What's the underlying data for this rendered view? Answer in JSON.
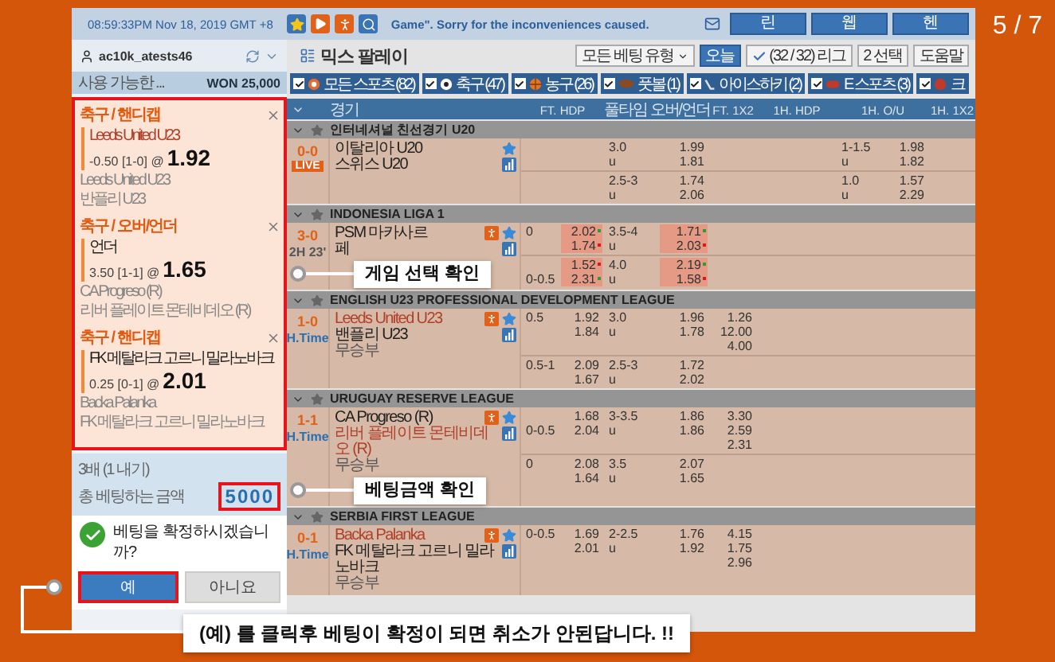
{
  "slide_counter": "5 / 7",
  "topbar": {
    "time": "08:59:33PM Nov 18, 2019 GMT +8",
    "notice": "Game\". Sorry for the inconveniences caused.",
    "buttons": [
      "린",
      "웹",
      "헨"
    ]
  },
  "account": {
    "username": "ac10k_atests46",
    "balance_label": "사용 가능한 ...",
    "balance": "WON 25,000"
  },
  "bet_slip": [
    {
      "category": "축구 / 핸디캡",
      "pick": "Leeds United U23",
      "favourite": true,
      "line": "-0.50 [1-0] @",
      "odds": "1.92",
      "home": "Leeds United U23",
      "away": "반플리 U23"
    },
    {
      "category": "축구 / 오버/언더",
      "pick": "언더",
      "favourite": false,
      "line": "3.50 [1-1] @",
      "odds": "1.65",
      "home": "CA Progreso (R)",
      "away": "리버 플레이트 몬테비데오 (R)"
    },
    {
      "category": "축구 / 핸디캡",
      "pick": "FK 메탈라크 고르니 밀라노바크",
      "favourite": false,
      "line": "0.25 [0-1] @",
      "odds": "2.01",
      "home": "Backa Palanka",
      "away": "FK 메탈라크 고르니 밀라노바크"
    }
  ],
  "summary": {
    "multiplier": "3배 (1 내기)",
    "total_label": "총 베팅하는 금액",
    "amount": "5000"
  },
  "confirm": {
    "question": "베팅을 확정하시겠습니까?",
    "yes": "예",
    "no": "아니요"
  },
  "main": {
    "title": "믹스 팔레이",
    "bet_type": "모든 베팅 유형",
    "today": "오늘",
    "leagues_filter": "(32 / 32) 리그",
    "selection": "2 선택",
    "help": "도움말"
  },
  "sport_tabs": [
    {
      "label": "모든 스포츠 (82)",
      "kind": "all",
      "checked": true
    },
    {
      "label": "축구 (47)",
      "kind": "soccer",
      "checked": true
    },
    {
      "label": "농구 (26)",
      "kind": "basketball",
      "checked": true
    },
    {
      "label": "풋볼 (1)",
      "kind": "football",
      "checked": true
    },
    {
      "label": "아이스하키 (2)",
      "kind": "hockey",
      "checked": true
    },
    {
      "label": "E 스포츠 (3)",
      "kind": "esports",
      "checked": true
    },
    {
      "label": "크",
      "kind": "other",
      "checked": true
    }
  ],
  "columns": [
    "경기",
    "FT. HDP",
    "풀타임 오버/언더",
    "FT. 1X2",
    "1H. HDP",
    "1H. O/U",
    "1H. 1X2"
  ],
  "leagues": [
    {
      "name": "인터네셔널 친선경기 U20",
      "matches": [
        {
          "score": "0-0",
          "status": {
            "text": "LIVE",
            "kind": "live"
          },
          "teams": [
            {
              "name": "이탈리아 U20",
              "kind": "team",
              "favourite": false,
              "stats": false
            },
            {
              "name": "스위스 U20",
              "kind": "team",
              "favourite": false,
              "stats": false
            }
          ],
          "groups": [
            [
              {
                "cells": [
                  null,
                  null,
                  "3.0",
                  "1.99",
                  null,
                  null,
                  "1-1.5",
                  "1.98"
                ]
              },
              {
                "cells": [
                  null,
                  null,
                  "u",
                  "1.81",
                  null,
                  null,
                  "u",
                  "1.82"
                ]
              }
            ],
            [
              {
                "cells": [
                  null,
                  null,
                  "2.5-3",
                  "1.74",
                  null,
                  null,
                  "1.0",
                  "1.57"
                ]
              },
              {
                "cells": [
                  null,
                  null,
                  "u",
                  "2.06",
                  null,
                  null,
                  "u",
                  "2.29"
                ]
              }
            ]
          ]
        }
      ]
    },
    {
      "name": "INDONESIA LIGA 1",
      "matches": [
        {
          "score": "3-0",
          "status": {
            "text": "2H 23'",
            "kind": "clock"
          },
          "teams": [
            {
              "name": "PSM 마카사르",
              "kind": "team",
              "favourite": false,
              "stats": true
            },
            {
              "name": "페",
              "kind": "team",
              "favourite": false,
              "stats": false
            }
          ],
          "groups": [
            [
              {
                "cells": [
                  "0",
                  "2.02",
                  "3.5-4",
                  "1.71"
                ],
                "hdp_rising": true,
                "ou_rising": true
              },
              {
                "cells": [
                  null,
                  "1.74",
                  "u",
                  "2.03"
                ],
                "hdp_rising": false,
                "ou_rising": false
              }
            ],
            [
              {
                "cells": [
                  null,
                  "1.52",
                  "4.0",
                  "2.19"
                ],
                "hdp_rising": false,
                "ou_rising": true
              },
              {
                "cells": [
                  "0-0.5",
                  "2.31",
                  "u",
                  "1.58"
                ],
                "hdp_rising": true,
                "ou_rising": false
              }
            ]
          ]
        }
      ]
    },
    {
      "name": "ENGLISH U23 PROFESSIONAL DEVELOPMENT LEAGUE",
      "matches": [
        {
          "score": "1-0",
          "status": {
            "text": "H.Time",
            "kind": "halftime"
          },
          "teams": [
            {
              "name": "Leeds United U23",
              "kind": "team",
              "favourite": true,
              "stats": true
            },
            {
              "name": "밴플리 U23",
              "kind": "team",
              "favourite": false,
              "stats": false
            },
            {
              "name": "무승부",
              "kind": "draw"
            }
          ],
          "groups": [
            [
              {
                "cells": [
                  "0.5",
                  "1.92",
                  "3.0",
                  "1.96",
                  "1.26"
                ]
              },
              {
                "cells": [
                  null,
                  "1.84",
                  "u",
                  "1.78",
                  "12.00"
                ]
              },
              {
                "cells": [
                  null,
                  null,
                  null,
                  null,
                  "4.00"
                ]
              }
            ],
            [
              {
                "cells": [
                  "0.5-1",
                  "2.09",
                  "2.5-3",
                  "1.72"
                ]
              },
              {
                "cells": [
                  null,
                  "1.67",
                  "u",
                  "2.02"
                ]
              }
            ]
          ]
        }
      ]
    },
    {
      "name": "URUGUAY RESERVE LEAGUE",
      "matches": [
        {
          "score": "1-1",
          "status": {
            "text": "H.Time",
            "kind": "halftime"
          },
          "teams": [
            {
              "name": "CA Progreso (R)",
              "kind": "team",
              "favourite": false,
              "stats": true
            },
            {
              "name": "리버 플레이트 몬테비데오 (R)",
              "kind": "team",
              "favourite": true,
              "stats": false
            },
            {
              "name": "무승부",
              "kind": "draw"
            }
          ],
          "groups": [
            [
              {
                "cells": [
                  null,
                  "1.68",
                  "3-3.5",
                  "1.86",
                  "3.30"
                ]
              },
              {
                "cells": [
                  "0-0.5",
                  "2.04",
                  "u",
                  "1.86",
                  "2.59"
                ]
              },
              {
                "cells": [
                  null,
                  null,
                  null,
                  null,
                  "2.31"
                ]
              }
            ],
            [
              {
                "cells": [
                  "0",
                  "2.08",
                  "3.5",
                  "2.07"
                ]
              },
              {
                "cells": [
                  null,
                  "1.64",
                  "u",
                  "1.65"
                ]
              }
            ]
          ]
        }
      ]
    },
    {
      "name": "SERBIA FIRST LEAGUE",
      "matches": [
        {
          "score": "0-1",
          "status": {
            "text": "H.Time",
            "kind": "halftime"
          },
          "teams": [
            {
              "name": "Backa Palanka",
              "kind": "team",
              "favourite": true,
              "stats": true
            },
            {
              "name": "FK 메탈라크 고르니 밀라노바크",
              "kind": "team",
              "favourite": false,
              "stats": false
            },
            {
              "name": "무승부",
              "kind": "draw"
            }
          ],
          "groups": [
            [
              {
                "cells": [
                  "0-0.5",
                  "1.69",
                  "2-2.5",
                  "1.76",
                  "4.15"
                ]
              },
              {
                "cells": [
                  null,
                  "2.01",
                  "u",
                  "1.92",
                  "1.75"
                ]
              },
              {
                "cells": [
                  null,
                  null,
                  null,
                  null,
                  "2.96"
                ]
              }
            ]
          ]
        }
      ]
    }
  ],
  "callouts": [
    {
      "text": "게임 선택 확인"
    },
    {
      "text": "베팅금액 확인"
    },
    {
      "text": "(예) 를 클릭후 베팅이 확정이 되면 취소가 안된답니다. !!"
    }
  ]
}
